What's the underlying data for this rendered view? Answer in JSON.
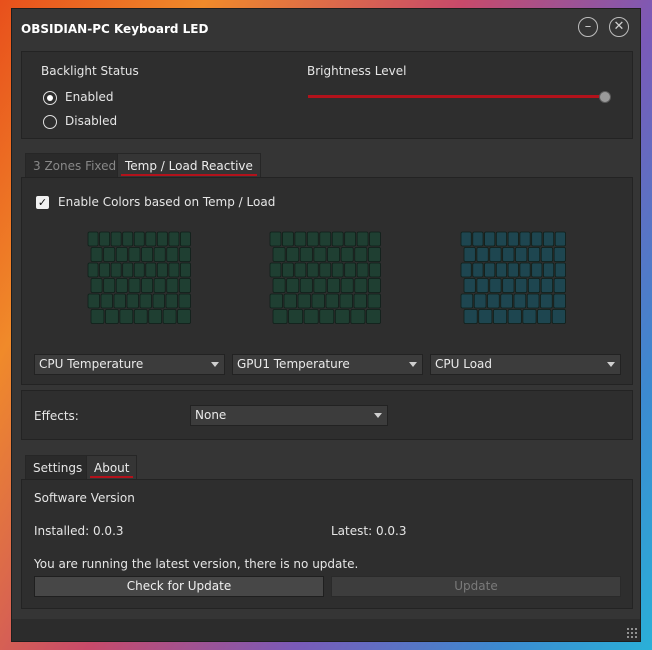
{
  "window": {
    "title": "OBSIDIAN-PC Keyboard LED"
  },
  "icons": {
    "minimize": "minimize-icon",
    "close": "close-icon",
    "check": "checkmark-icon",
    "grip": "resize-grip-icon"
  },
  "colors": {
    "accent": "#b3121b",
    "kbd_green": "#1f3f32",
    "kbd_teal": "#1e4650"
  },
  "backlight": {
    "label": "Backlight Status",
    "options": [
      {
        "label": "Enabled",
        "selected": true
      },
      {
        "label": "Disabled",
        "selected": false
      }
    ]
  },
  "brightness": {
    "label": "Brightness Level",
    "value_fraction": 1.0
  },
  "mode_tabs": [
    {
      "label": "3 Zones Fixed",
      "active": false
    },
    {
      "label": "Temp / Load Reactive",
      "active": true
    }
  ],
  "reactive": {
    "enable_label": "Enable Colors based on Temp / Load",
    "enabled": true,
    "zones": [
      {
        "source": "CPU Temperature",
        "tint": "green"
      },
      {
        "source": "GPU1 Temperature",
        "tint": "green"
      },
      {
        "source": "CPU Load",
        "tint": "teal"
      }
    ]
  },
  "effects": {
    "label": "Effects:",
    "value": "None"
  },
  "info_tabs": [
    {
      "label": "Settings",
      "active": false
    },
    {
      "label": "About",
      "active": true
    }
  ],
  "about": {
    "heading": "Software Version",
    "installed": "Installed: 0.0.3",
    "latest": "Latest: 0.0.3",
    "message": "You are running the latest version, there is no update.",
    "check_button": "Check for Update",
    "update_button": "Update"
  }
}
